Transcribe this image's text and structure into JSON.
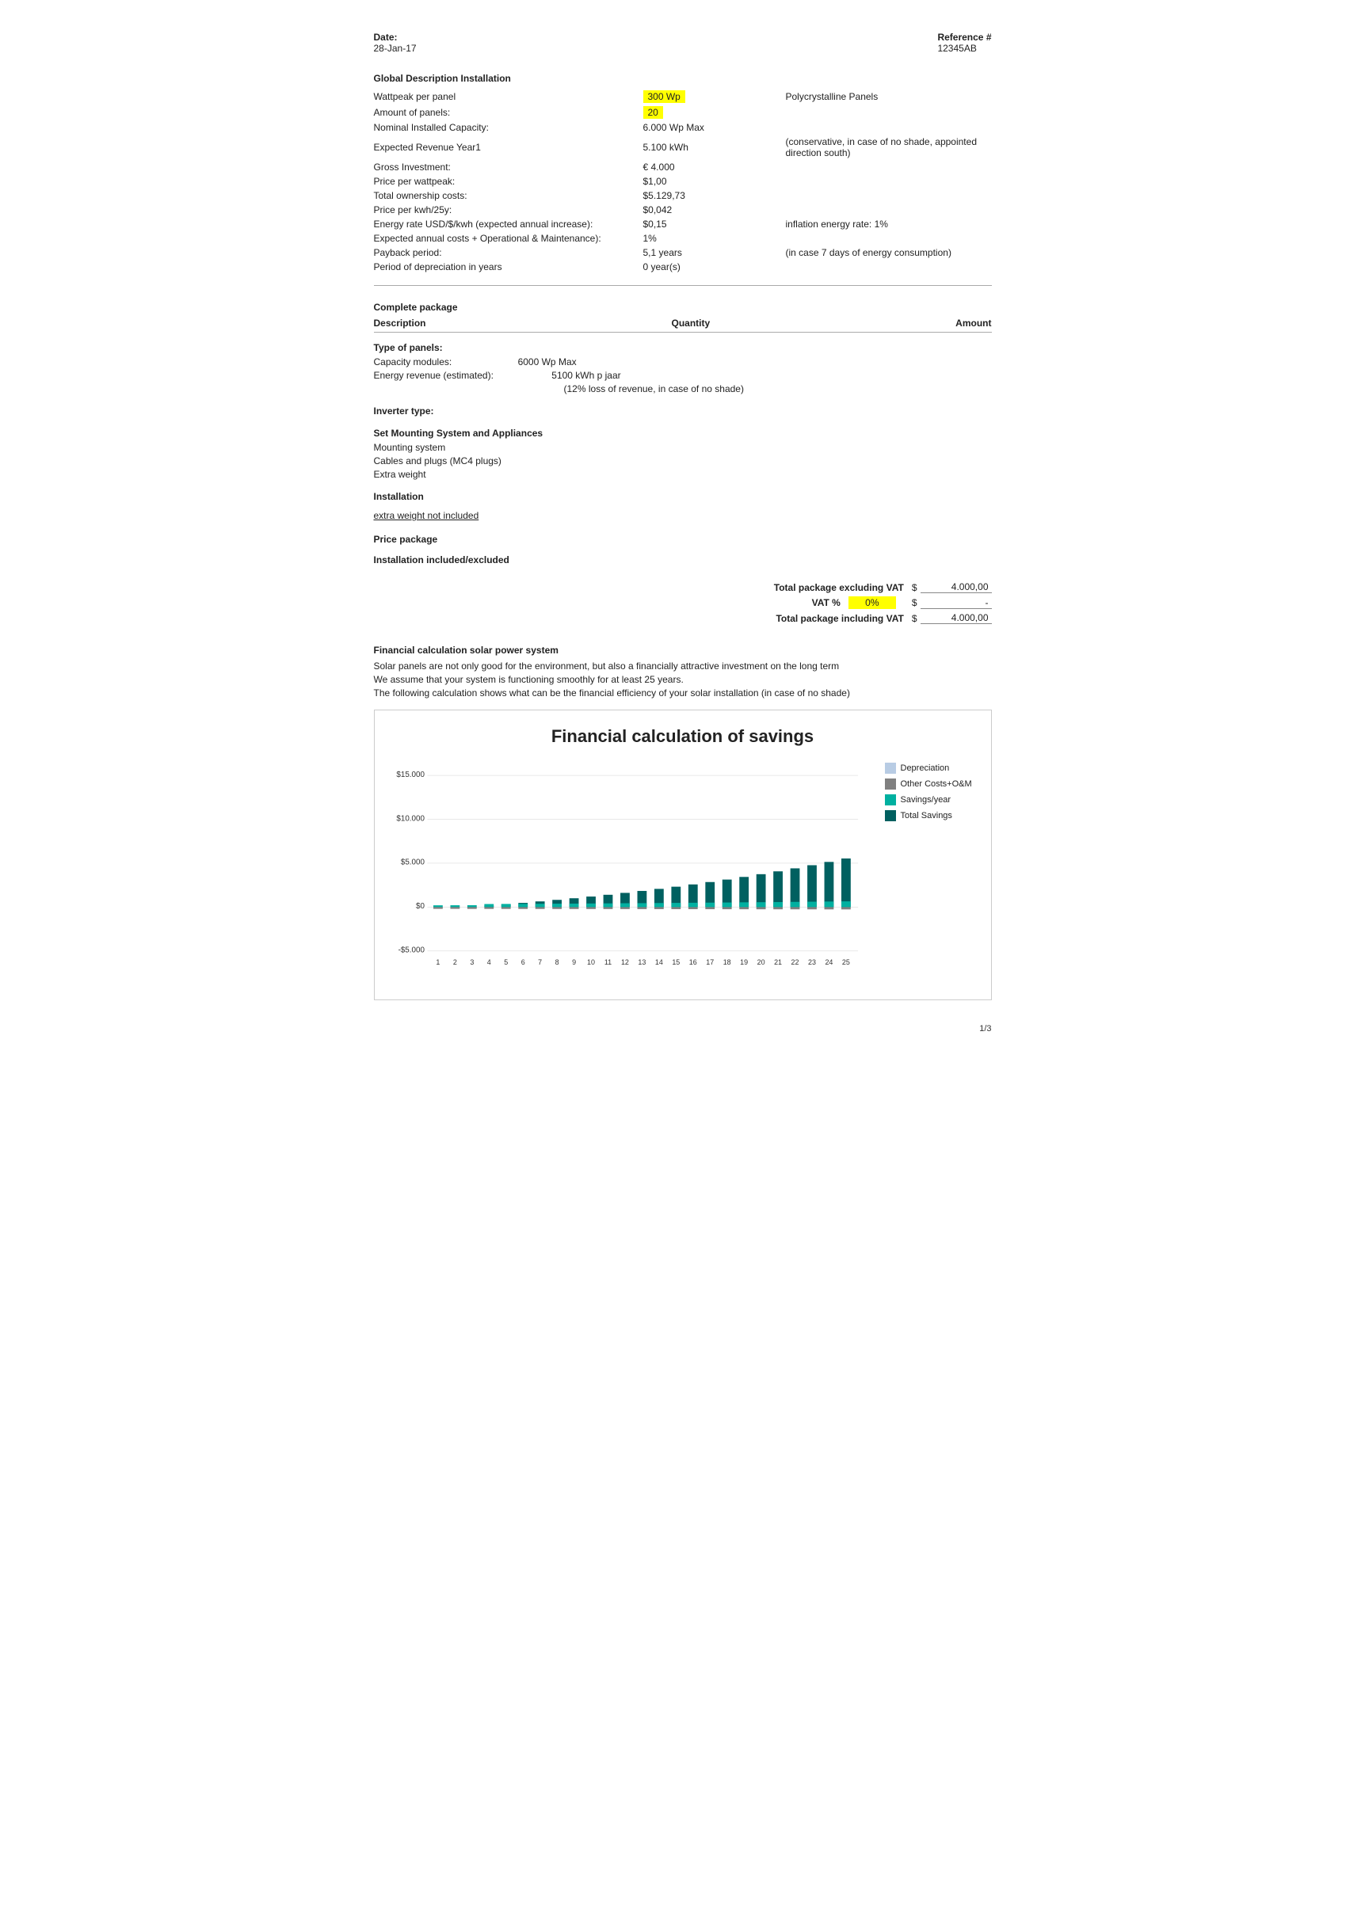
{
  "header": {
    "date_label": "Date:",
    "date_value": "28-Jan-17",
    "reference_label": "Reference #",
    "reference_value": "12345AB"
  },
  "global": {
    "section_title": "Global Description Installation",
    "rows": [
      {
        "label": "Wattpeak per panel",
        "value1": "300 Wp",
        "value1_highlight": true,
        "value2": "Polycrystalline Panels"
      },
      {
        "label": "Amount of panels:",
        "value1": "20",
        "value1_highlight": true,
        "value2": ""
      },
      {
        "label": "Nominal Installed Capacity:",
        "value1": "6.000 Wp Max",
        "value2": ""
      },
      {
        "label": "Expected Revenue Year1",
        "value1": "5.100 kWh",
        "value2": "(conservative, in case of no shade, appointed direction south)"
      },
      {
        "label": "Gross Investment:",
        "value1": "€ 4.000",
        "value2": ""
      },
      {
        "label": "Price per wattpeak:",
        "value1": "$1,00",
        "value2": ""
      },
      {
        "label": "Total ownership costs:",
        "value1": "$5.129,73",
        "value2": ""
      },
      {
        "label": "Price per kwh/25y:",
        "value1": "$0,042",
        "value2": ""
      },
      {
        "label": "Energy rate USD/$/kwh (expected annual increase):",
        "value1": "$0,15",
        "value2": "inflation energy rate:   1%"
      },
      {
        "label": "Expected annual costs + Operational & Maintenance):",
        "value1": "1%",
        "value2": ""
      },
      {
        "label": "Payback period:",
        "value1": "5,1 years",
        "value2": "(in case 7 days of energy consumption)"
      },
      {
        "label": "Period of depreciation in years",
        "value1": "0 year(s)",
        "value2": ""
      }
    ]
  },
  "complete_package": {
    "section_title": "Complete package",
    "col_description": "Description",
    "col_quantity": "Quantity",
    "col_amount": "Amount",
    "type_of_panels_label": "Type of panels:",
    "capacity_label": "Capacity modules:",
    "capacity_value": "6000 Wp Max",
    "energy_revenue_label": "Energy revenue (estimated):",
    "energy_revenue_value": "5100 kWh p jaar",
    "energy_note": "(12% loss of revenue, in case of no shade)",
    "inverter_label": "Inverter type:",
    "set_mounting_label": "Set Mounting System and Appliances",
    "mounting_system": "Mounting system",
    "cables_plugs": "Cables and plugs (MC4 plugs)",
    "extra_weight": "Extra weight",
    "installation_label": "Installation",
    "extra_weight_note": "extra weight not included",
    "price_package_label": "Price package",
    "installation_included": "Installation included/excluded"
  },
  "totals": {
    "excl_vat_label": "Total package excluding VAT",
    "excl_vat_amount": "4.000,00",
    "vat_label": "VAT %",
    "vat_value": "0%",
    "incl_vat_label": "Total package including VAT",
    "incl_vat_amount": "4.000,00",
    "vat_dash": "-",
    "currency": "$"
  },
  "financial": {
    "section_title": "Financial calculation solar power system",
    "lines": [
      "Solar panels are not only good for the environment, but also a financially attractive investment on the long term",
      "We assume that your system is functioning smoothly for at least 25 years.",
      "The following calculation shows what can be the financial efficiency of your solar installation (in case of no shade)"
    ],
    "chart_title": "Financial calculation of savings",
    "y_labels": [
      "$15.000",
      "$10.000",
      "$5.000",
      "$0",
      "-$5.000"
    ],
    "x_labels": [
      "1",
      "2",
      "3",
      "4",
      "5",
      "6",
      "7",
      "8",
      "9",
      "10",
      "11",
      "12",
      "13",
      "14",
      "15",
      "16",
      "17",
      "18",
      "19",
      "20",
      "21",
      "22",
      "23",
      "24",
      "25"
    ],
    "legend": [
      {
        "label": "Depreciation",
        "color": "#b8cce4"
      },
      {
        "label": "Other Costs+O&M",
        "color": "#808080"
      },
      {
        "label": "Savings/year",
        "color": "#00b0a0"
      },
      {
        "label": "Total Savings",
        "color": "#006060"
      }
    ],
    "bars": [
      {
        "depreciation": 0,
        "other_costs": 200,
        "savings": 204,
        "total_savings": 4
      },
      {
        "depreciation": 0,
        "other_costs": 200,
        "savings": 210,
        "total_savings": 14
      },
      {
        "depreciation": 0,
        "other_costs": 205,
        "savings": 215,
        "total_savings": 24
      },
      {
        "depreciation": 0,
        "other_costs": 205,
        "savings": 350,
        "total_savings": 169
      },
      {
        "depreciation": 0,
        "other_costs": 208,
        "savings": 360,
        "total_savings": 321
      },
      {
        "depreciation": 0,
        "other_costs": 210,
        "savings": 370,
        "total_savings": 481
      },
      {
        "depreciation": 0,
        "other_costs": 212,
        "savings": 380,
        "total_savings": 649
      },
      {
        "depreciation": 0,
        "other_costs": 215,
        "savings": 390,
        "total_savings": 824
      },
      {
        "depreciation": 0,
        "other_costs": 217,
        "savings": 400,
        "total_savings": 1007
      },
      {
        "depreciation": 0,
        "other_costs": 220,
        "savings": 415,
        "total_savings": 1202
      },
      {
        "depreciation": 0,
        "other_costs": 222,
        "savings": 425,
        "total_savings": 1405
      },
      {
        "depreciation": 0,
        "other_costs": 225,
        "savings": 440,
        "total_savings": 1620
      },
      {
        "depreciation": 0,
        "other_costs": 228,
        "savings": 450,
        "total_savings": 1842
      },
      {
        "depreciation": 0,
        "other_costs": 230,
        "savings": 465,
        "total_savings": 2077
      },
      {
        "depreciation": 0,
        "other_costs": 233,
        "savings": 480,
        "total_savings": 2324
      },
      {
        "depreciation": 0,
        "other_costs": 236,
        "savings": 495,
        "total_savings": 2583
      },
      {
        "depreciation": 0,
        "other_costs": 239,
        "savings": 510,
        "total_savings": 2854
      },
      {
        "depreciation": 0,
        "other_costs": 242,
        "savings": 525,
        "total_savings": 3137
      },
      {
        "depreciation": 0,
        "other_costs": 245,
        "savings": 545,
        "total_savings": 3437
      },
      {
        "depreciation": 0,
        "other_costs": 248,
        "savings": 560,
        "total_savings": 3749
      },
      {
        "depreciation": 0,
        "other_costs": 251,
        "savings": 575,
        "total_savings": 4073
      },
      {
        "depreciation": 0,
        "other_costs": 254,
        "savings": 595,
        "total_savings": 4414
      },
      {
        "depreciation": 0,
        "other_costs": 257,
        "savings": 615,
        "total_savings": 4772
      },
      {
        "depreciation": 0,
        "other_costs": 261,
        "savings": 635,
        "total_savings": 5146
      },
      {
        "depreciation": 0,
        "other_costs": 264,
        "savings": 655,
        "total_savings": 5537
      }
    ]
  },
  "page_number": "1/3"
}
